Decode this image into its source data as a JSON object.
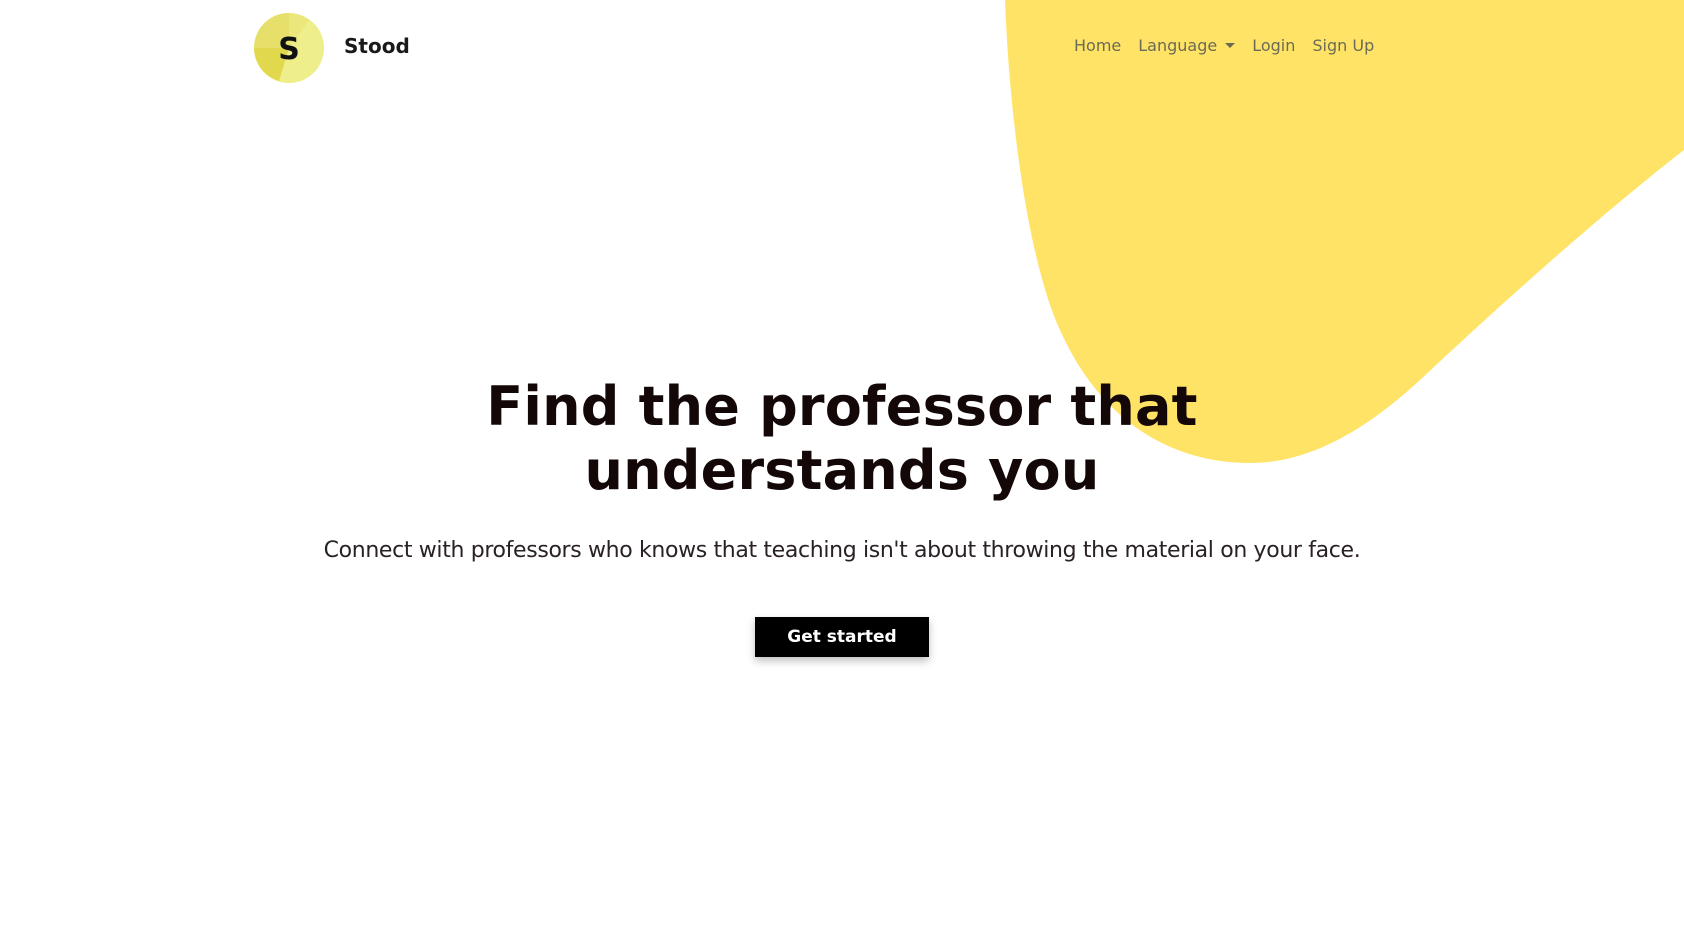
{
  "colors": {
    "accent_yellow": "#FFE366",
    "logo_light": "#EEEE8A",
    "logo_dark": "#E2D84E",
    "text_dark": "#140707",
    "nav_text": "#6B6B55",
    "button_bg": "#000000",
    "button_text": "#FFFFFF"
  },
  "brand": {
    "logo_letter": "S",
    "name": "Stood"
  },
  "nav": {
    "items": [
      {
        "label": "Home"
      },
      {
        "label": "Language",
        "has_dropdown": true
      },
      {
        "label": "Login"
      },
      {
        "label": "Sign Up"
      }
    ]
  },
  "hero": {
    "title": "Find the professor that understands you",
    "subtitle": "Connect with professors who knows that teaching isn't about throwing the material on your face.",
    "cta_label": "Get started"
  }
}
